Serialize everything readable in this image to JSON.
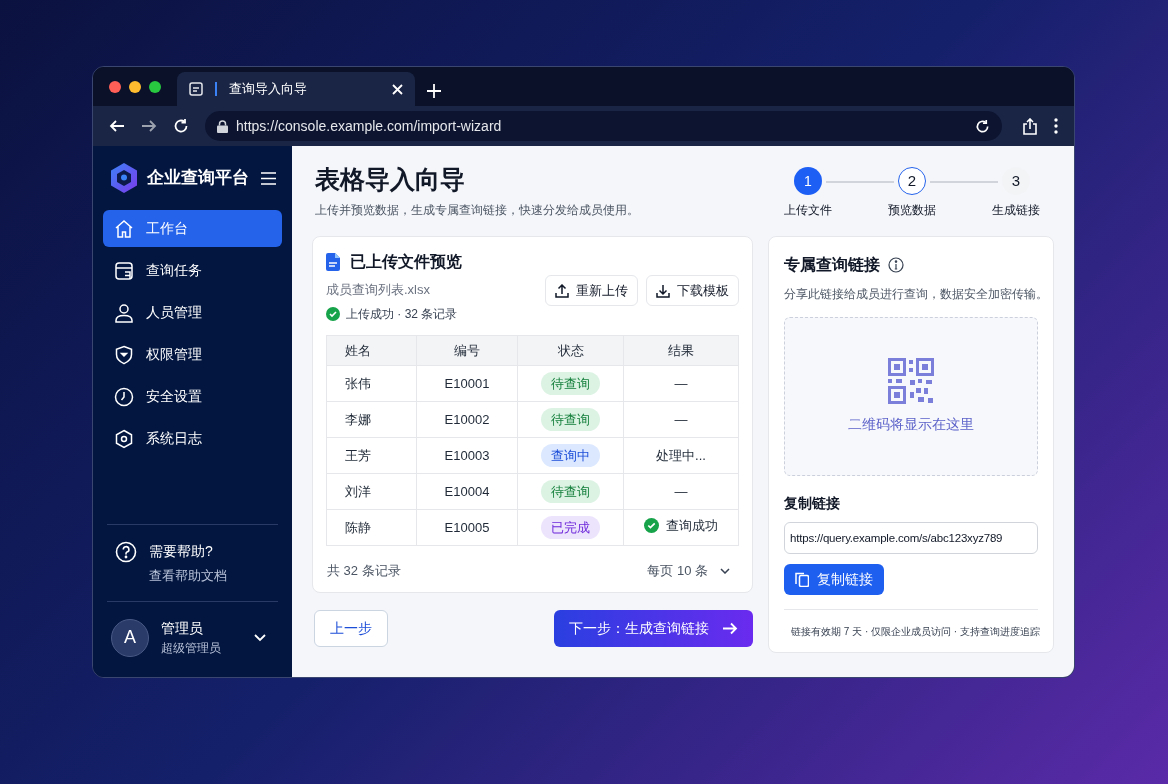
{
  "browser": {
    "tab_title": "查询导入向导",
    "url": "https://console.example.com/import-wizard"
  },
  "sidebar": {
    "brand": "企业查询平台",
    "items": [
      {
        "label": "工作台",
        "selected": true
      },
      {
        "label": "查询任务",
        "selected": false
      },
      {
        "label": "人员管理",
        "selected": false
      },
      {
        "label": "权限管理",
        "selected": false
      },
      {
        "label": "安全设置",
        "selected": false
      },
      {
        "label": "系统日志",
        "selected": false
      }
    ],
    "help": {
      "title": "需要帮助?",
      "link": "查看帮助文档"
    },
    "user": {
      "avatar": "A",
      "name": "管理员",
      "role": "超级管理员"
    }
  },
  "page": {
    "title": "表格导入向导",
    "subtitle": "上传并预览数据，生成专属查询链接，快速分发给成员使用。"
  },
  "steps": [
    {
      "number": "1",
      "label": "上传文件",
      "kind": "done"
    },
    {
      "number": "2",
      "label": "预览数据",
      "kind": "current"
    },
    {
      "number": "3",
      "label": "生成链接",
      "kind": "todo"
    }
  ],
  "preview": {
    "title": "已上传文件预览",
    "filename": "成员查询列表.xlsx",
    "status": "上传成功 · 32 条记录",
    "buttons": [
      "重新上传",
      "下载模板"
    ],
    "table": {
      "columns": [
        "姓名",
        "编号",
        "状态",
        "结果"
      ],
      "rows": [
        {
          "name": "张伟",
          "id": "E10001",
          "status": "待查询",
          "kind": "pending",
          "result": "—",
          "success": false
        },
        {
          "name": "李娜",
          "id": "E10002",
          "status": "待查询",
          "kind": "pending",
          "result": "—",
          "success": false
        },
        {
          "name": "王芳",
          "id": "E10003",
          "status": "查询中",
          "kind": "running",
          "result": "处理中...",
          "success": false
        },
        {
          "name": "刘洋",
          "id": "E10004",
          "status": "待查询",
          "kind": "pending",
          "result": "—",
          "success": false
        },
        {
          "name": "陈静",
          "id": "E10005",
          "status": "已完成",
          "kind": "done",
          "result": "查询成功",
          "success": true
        }
      ]
    },
    "total": "共 32 条记录",
    "page_size": "每页 10 条"
  },
  "nav": {
    "back": "上一步",
    "next": "下一步：生成查询链接"
  },
  "link_card": {
    "title": "专属查询链接",
    "description": "分享此链接给成员进行查询，数据安全加密传输。",
    "qr_placeholder": "二维码将显示在这里",
    "copy_label": "复制链接",
    "url": "https://query.example.com/s/abc123xyz789",
    "copy_button": "复制链接",
    "note": "链接有效期 7 天 · 仅限企业成员访问 · 支持查询进度追踪"
  }
}
